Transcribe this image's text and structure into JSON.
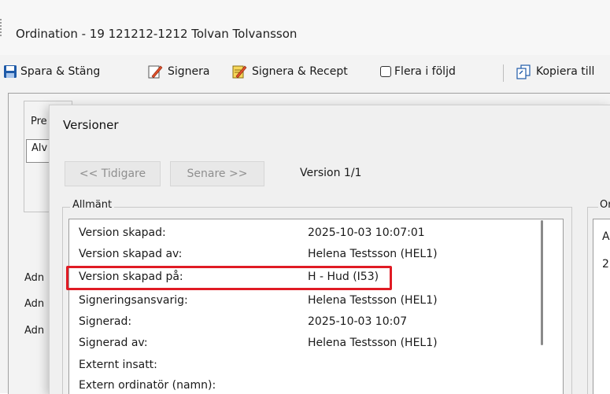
{
  "window": {
    "title": "Ordination - 19 121212-1212 Tolvan Tolvansson"
  },
  "toolbar": {
    "save_close": "Spara & Stäng",
    "sign": "Signera",
    "sign_recipe": "Signera & Recept",
    "multi": "Flera i följd",
    "copy": "Kopiera till"
  },
  "background_form": {
    "pre_label": "Pre",
    "pre_value": "Alv",
    "adm_labels": [
      "Adn",
      "Adn",
      "Adn"
    ]
  },
  "dialog": {
    "title": "Versioner",
    "prev_button": "<< Tidigare",
    "next_button": "Senare >>",
    "version_label": "Version 1/1",
    "general_group": "Allmänt",
    "rows": [
      {
        "key": "Version skapad:",
        "value": "2025-10-03 10:07:01"
      },
      {
        "key": "Version skapad av:",
        "value": "Helena Testsson (HEL1)"
      },
      {
        "key": "Version skapad på:",
        "value": "H - Hud (I53)"
      },
      {
        "key": "Signeringsansvarig:",
        "value": "Helena Testsson (HEL1)"
      },
      {
        "key": "Signerad:",
        "value": "2025-10-03 10:07"
      },
      {
        "key": "Signerad av:",
        "value": "Helena Testsson (HEL1)"
      },
      {
        "key": "Externt insatt:",
        "value": ""
      },
      {
        "key": "Extern ordinatör (namn):",
        "value": ""
      }
    ],
    "ordination_group": "Or",
    "ordination_lines": [
      "A",
      "2"
    ]
  },
  "colors": {
    "highlight": "#e01b24",
    "save_icon": "#1e5aa8"
  },
  "icons": {
    "save": "floppy-disk-icon",
    "sign": "pen-document-icon",
    "sign_recipe": "pen-notepad-icon",
    "copy": "copy-documents-icon"
  }
}
